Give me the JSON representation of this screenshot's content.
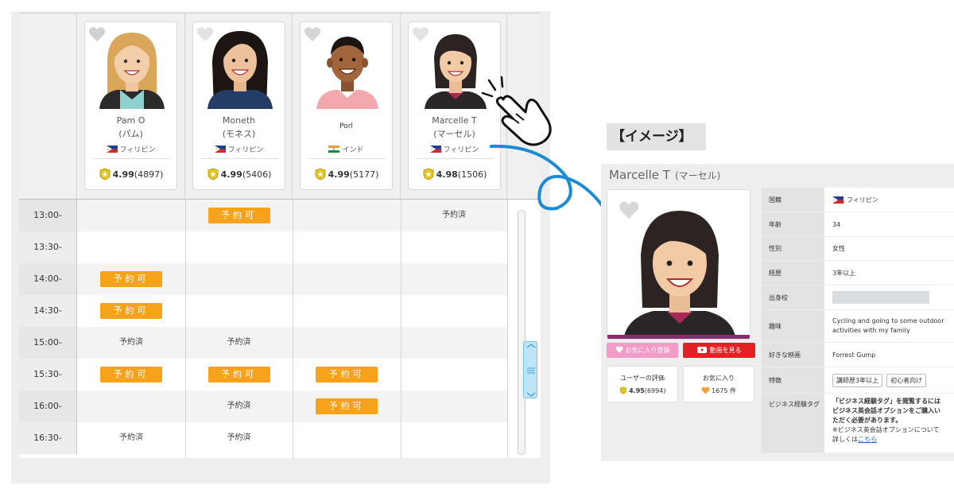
{
  "schedule": {
    "teachers": [
      {
        "name_line1": "Pam O",
        "name_line2": "(パム)",
        "country": "フィリピン",
        "rating": "4.99",
        "reviews": "(4897)",
        "flag": "ph"
      },
      {
        "name_line1": "Moneth",
        "name_line2": "(モネス)",
        "country": "フィリピン",
        "rating": "4.99",
        "reviews": "(5406)",
        "flag": "ph"
      },
      {
        "name_line1": "Porl",
        "name_line2": "",
        "country": "インド",
        "rating": "4.99",
        "reviews": "(5177)",
        "flag": "in"
      },
      {
        "name_line1": "Marcelle T",
        "name_line2": "(マーセル)",
        "country": "フィリピン",
        "rating": "4.98",
        "reviews": "(1506)",
        "flag": "ph"
      }
    ],
    "times": [
      "13:00-",
      "13:30-",
      "14:00-",
      "14:30-",
      "15:00-",
      "15:30-",
      "16:00-",
      "16:30-"
    ],
    "available_label": "予約可",
    "booked_label": "予約済",
    "slots": [
      [
        "",
        "available",
        "",
        "booked"
      ],
      [
        "",
        "",
        "",
        ""
      ],
      [
        "available",
        "",
        "",
        ""
      ],
      [
        "available",
        "",
        "",
        ""
      ],
      [
        "booked",
        "booked",
        "",
        ""
      ],
      [
        "available",
        "available",
        "available",
        ""
      ],
      [
        "",
        "booked",
        "available",
        ""
      ],
      [
        "booked",
        "booked",
        "",
        ""
      ]
    ]
  },
  "image_tag": "【イメージ】",
  "profile": {
    "name": "Marcelle T",
    "name_kana": "(マーセル)",
    "fav_button": "お気に入り登録",
    "video_button": "動画を見る",
    "rating_title": "ユーザーの評価",
    "rating_value": "4.95",
    "rating_count": "(6994)",
    "fav_title": "お気に入り",
    "fav_count": "1675 件",
    "fields": {
      "nationality_label": "国籍",
      "nationality_value": "フィリピン",
      "age_label": "年齢",
      "age_value": "34",
      "gender_label": "性別",
      "gender_value": "女性",
      "career_label": "経歴",
      "career_value": "3年以上",
      "school_label": "出身校",
      "hobby_label": "趣味",
      "hobby_value": "Cycling and going to some outdoor activities with my family",
      "movie_label": "好きな映画",
      "movie_value": "Forrest Gump",
      "feature_label": "特徴",
      "feature_tag1": "講師歴3年以上",
      "feature_tag2": "初心者向け",
      "biz_label": "ビジネス経験タグ",
      "biz_line1": "「ビジネス経験タグ」を閲覧するには",
      "biz_line2": "ビジネス英会話オプションをご購入い",
      "biz_line3": "ただく必要があります。",
      "biz_line4": "※ビジネス英会話オプションについて",
      "biz_line5_pre": "詳しくは",
      "biz_link": "こちら"
    }
  },
  "colors": {
    "available": "#f7a21b",
    "video_red": "#e32124",
    "fav_pink": "#f29bc6",
    "arrow_blue": "#1b8bd6",
    "rating_star": "#d6b21a"
  }
}
